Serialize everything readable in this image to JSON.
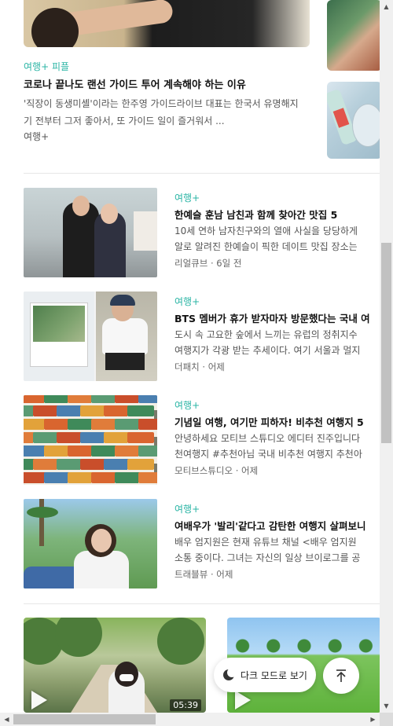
{
  "featured": {
    "category": "여행+ 피플",
    "title": "코로나 끝나도 랜선 가이드 투어 계속해야 하는 이유",
    "description": "'직장이 동생미셸'이라는 한주영 가이드라이브 대표는 한국서 유명해지기 전부터 그저 좋아서, 또 가이드 일이 즐거워서 ...",
    "source": "여행+"
  },
  "articles": [
    {
      "category": "여행+",
      "title": "한예슬 훈남 남친과 함께 찾아간 맛집 5",
      "description": [
        "10세 연하 남자친구와의 열애 사실을 당당하게",
        "알로 알려진 한예슬이 픽한 데이트 맛집 장소는"
      ],
      "source": "리얼큐브",
      "time": "6일 전"
    },
    {
      "category": "여행+",
      "title": "BTS 멤버가 휴가 받자마자 방문했다는 국내 여",
      "description": [
        "도시 속 고요한 숲에서 느끼는 유럽의 정취지수",
        "여행지가 각광 받는 추세이다. 여기 서울과 멀지"
      ],
      "source": "더패치",
      "time": "어제"
    },
    {
      "category": "여행+",
      "title": "기념일 여행, 여기만 피하자! 비추천 여행지 5",
      "description": [
        "안녕하세요 모티브 스튜디오 에디터 진주입니다",
        "천여행지 #추천아님 국내 비추천 여행지 추천아"
      ],
      "source": "모티브스튜디오",
      "time": "어제"
    },
    {
      "category": "여행+",
      "title": "여배우가 '발리'같다고 감탄한 여행지 살펴보니",
      "description": [
        "배우 엄지원은 현재 유튜브 채널 <배우 엄지원",
        "소통 중이다. 그녀는 자신의 일상 브이로그를 공"
      ],
      "source": "트래블뷰",
      "time": "어제"
    }
  ],
  "meta_separator": " · ",
  "videos": [
    {
      "duration": "05:39"
    },
    {
      "duration": ""
    }
  ],
  "floating": {
    "dark_mode_label": "다크 모드로 보기"
  },
  "colors": {
    "accent": "#2bb5a5",
    "title": "#111111",
    "muted": "#555555"
  }
}
